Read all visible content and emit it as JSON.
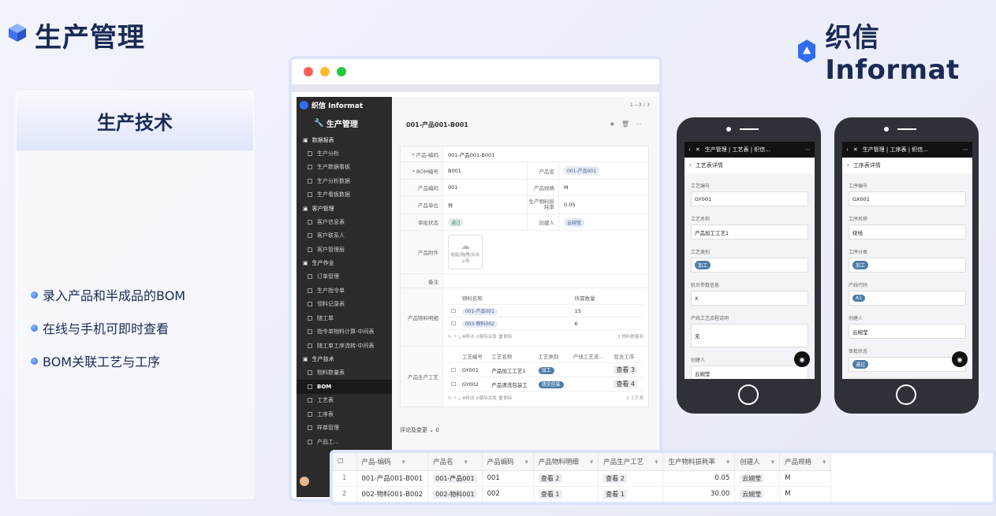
{
  "header": {
    "title": "生产管理",
    "logo_text": "织信 Informat"
  },
  "left_panel": {
    "heading": "生产技术",
    "bullets": [
      "录入产品和半成品的BOM",
      "在线与手机可即时查看",
      "BOM关联工艺与工序"
    ]
  },
  "app": {
    "brand": "织信 Informat",
    "app_name": "生产管理",
    "pager": "1—3 / 3",
    "record_title": "001-产品001-B001",
    "sidebar": [
      {
        "group": "数据报表",
        "items": [
          "生产分析",
          "生产数据看板",
          "生产分析数据",
          "生产看板数据"
        ]
      },
      {
        "group": "客户管理",
        "items": [
          "客户信息表",
          "客户联系人",
          "客户管理层"
        ]
      },
      {
        "group": "生产作业",
        "items": [
          "订单管理",
          "生产指令单",
          "领料记录表",
          "随工单",
          "指令单物料计算-中间表",
          "随工单工序流转-中间表"
        ]
      },
      {
        "group": "生产技术",
        "items": [
          "物料数量表",
          "BOM",
          "工艺表",
          "工序表",
          "样单管理",
          "产品工..."
        ]
      }
    ],
    "form": {
      "product_bom_code_label": "* 产品-编码",
      "product_bom_code": "001-产品001-B001",
      "bom_no_label": "* BOM编号",
      "bom_no": "B001",
      "product_name_label": "产品名",
      "product_name": "001-产品001",
      "product_code_label": "产品编码",
      "product_code": "001",
      "spec_label": "产品规格",
      "spec": "M",
      "unit_label": "产品单位",
      "unit": "件",
      "loss_label": "生产物料损耗率",
      "loss": "0.05",
      "status_label": "审批状态",
      "status": "通过",
      "creator_label": "创建人",
      "creator": "云婉莹",
      "attach_label": "产品附件",
      "upload_hint": "粘贴/拖拽/点击上传",
      "remark_label": "备注",
      "material_label": "产品物料明细",
      "material_headers": [
        "物料名称",
        "所需数量"
      ],
      "materials": [
        {
          "name": "001-产品001",
          "qty": "15"
        },
        {
          "name": "003-物料002",
          "qty": "6"
        }
      ],
      "material_count": "2 物料数量表",
      "process_label": "产品生产工艺",
      "process_headers": [
        "工艺编号",
        "工艺名称",
        "工艺类别",
        "产线工艺流...",
        "包含工序"
      ],
      "processes": [
        {
          "code": "GY001",
          "name": "产品加工工艺1",
          "type": "加工",
          "view": "查看 3"
        },
        {
          "code": "GY002",
          "name": "产品清洗包装工",
          "type": "清洗包装",
          "view": "查看 4"
        }
      ],
      "process_count": "2 工艺表",
      "toolbar": [
        "移动",
        "解除关联",
        "删除"
      ],
      "comments": "评论及变更"
    }
  },
  "phone1": {
    "nav_title": "生产管理 | 工艺表 | 织信...",
    "sub_title": "工艺表详情",
    "fields": [
      {
        "label": "工艺编号",
        "value": "GY001"
      },
      {
        "label": "工艺名称",
        "value": "产品加工工艺1"
      },
      {
        "label": "工艺类别",
        "value": "加工"
      },
      {
        "label": "机台参数信息",
        "value": "X"
      },
      {
        "label": "产线工艺流程说明",
        "value": "无"
      },
      {
        "label": "创建人",
        "value": "云婉莹"
      }
    ],
    "edit_label": "编辑"
  },
  "phone2": {
    "nav_title": "生产管理 | 工序表 | 织信...",
    "sub_title": "工序表详情",
    "fields": [
      {
        "label": "工序编号",
        "value": "GX001"
      },
      {
        "label": "工序名称",
        "value": "绕线"
      },
      {
        "label": "工序分类",
        "value": "加工"
      },
      {
        "label": "产线代码",
        "value": "A1"
      },
      {
        "label": "创建人",
        "value": "云婉莹"
      },
      {
        "label": "审批状态",
        "value": "通过"
      }
    ]
  },
  "grid": {
    "headers": [
      "产品-编码",
      "产品名",
      "产品编码",
      "产品物料明细",
      "产品生产工艺",
      "生产物料损耗率",
      "创建人",
      "产品规格"
    ],
    "rows": [
      {
        "idx": "1",
        "code": "001-产品001-B001",
        "name": "001-产品001",
        "pcode": "001",
        "mat": "查看 2",
        "proc": "查看 2",
        "loss": "0.05",
        "creator": "云婉莹",
        "spec": "M"
      },
      {
        "idx": "2",
        "code": "002-物料001-B002",
        "name": "002-物料001",
        "pcode": "002",
        "mat": "查看 1",
        "proc": "查看 1",
        "loss": "30.00",
        "creator": "云婉莹",
        "spec": "M"
      }
    ]
  },
  "colors": {
    "navy": "#1b2a55",
    "brand_blue": "#2f6cf0",
    "mac_red": "#ff5f57",
    "mac_yellow": "#febc2e",
    "mac_green": "#28c840",
    "sidebar_bg": "#2b2b2b"
  }
}
